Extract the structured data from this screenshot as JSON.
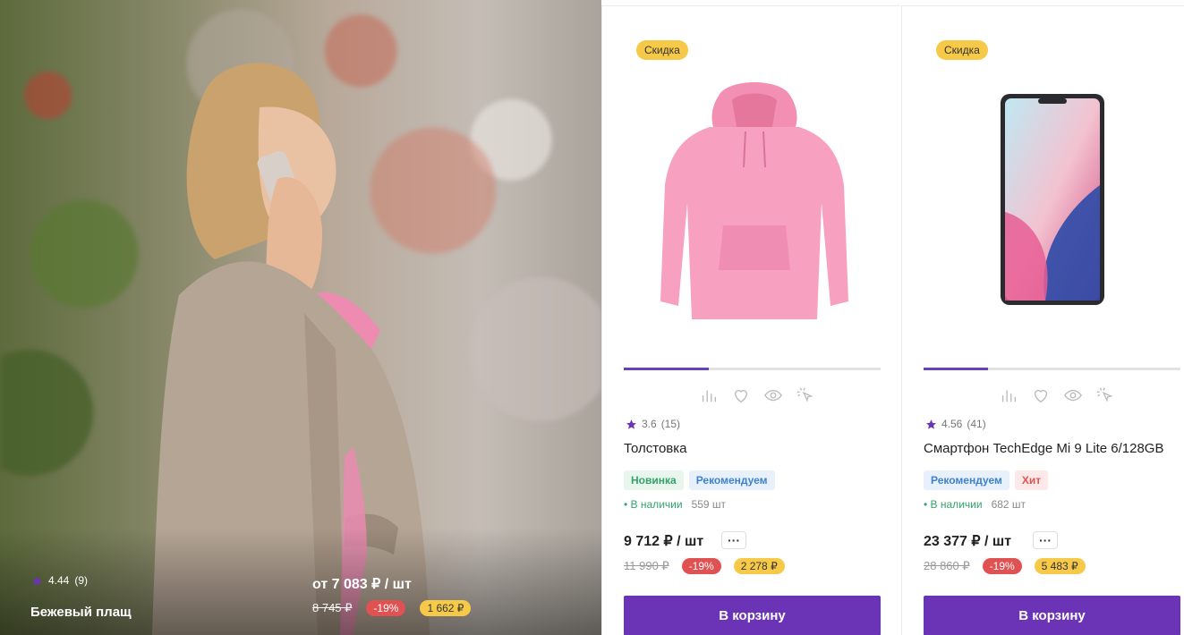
{
  "hero": {
    "rating": "4.44",
    "reviews": "(9)",
    "title": "Бежевый плащ",
    "price": "от 7 083 ₽ / шт",
    "old_price": "8 745 ₽",
    "discount": "-19%",
    "bonus": "1 662 ₽"
  },
  "cards": [
    {
      "badge": "Скидка",
      "rating": "3.6",
      "reviews": "(15)",
      "name": "Толстовка",
      "labels": [
        "Новинка",
        "Рекомендуем"
      ],
      "availability": "В наличии",
      "quantity": "559 шт",
      "price": "9 712 ₽ / шт",
      "more": "···",
      "old_price": "11 990 ₽",
      "discount": "-19%",
      "bonus": "2 278 ₽",
      "cart_label": "В корзину",
      "gallery_progress": 0.33
    },
    {
      "badge": "Скидка",
      "rating": "4.56",
      "reviews": "(41)",
      "name": "Смартфон TechEdge Mi 9 Lite 6/128GB",
      "labels": [
        "Рекомендуем",
        "Хит"
      ],
      "availability": "В наличии",
      "quantity": "682 шт",
      "price": "23 377 ₽ / шт",
      "more": "···",
      "old_price": "28 860 ₽",
      "discount": "-19%",
      "bonus": "5 483 ₽",
      "cart_label": "В корзину",
      "gallery_progress": 0.25
    }
  ],
  "icons": {
    "compare": "bar-chart-icon",
    "favorite": "heart-icon",
    "quick_view": "eye-icon",
    "click": "pointer-click-icon",
    "rating": "star-icon"
  },
  "colors": {
    "accent": "#6b34b6",
    "discount": "#e05252",
    "bonus": "#f7c948",
    "in_stock": "#33a36a"
  }
}
